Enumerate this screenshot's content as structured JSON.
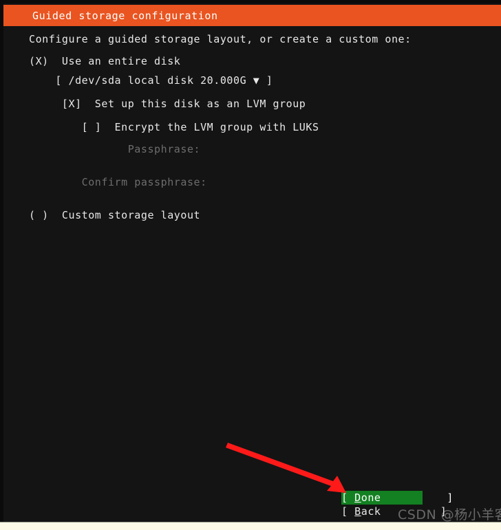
{
  "colors": {
    "header_bg": "#e95420",
    "screen_bg": "#141414",
    "text": "#e8e8e8",
    "dim_text": "#6d6d6d",
    "selected_bg": "#138021",
    "arrow": "#ff1a1a",
    "bottom_strip": "#fdfbe8"
  },
  "header": {
    "title": "Guided storage configuration"
  },
  "main": {
    "intro": "Configure a guided storage layout, or create a custom one:",
    "rows": [
      {
        "name": "use-entire-disk-radio",
        "text": "(X)  Use an entire disk",
        "dim": false,
        "interactable": true
      },
      {
        "name": "disk-selector",
        "text": "    [ /dev/sda local disk 20.000G ▼ ]",
        "dim": false,
        "interactable": true
      },
      {
        "name": "lvm-group-checkbox",
        "text": "     [X]  Set up this disk as an LVM group",
        "dim": false,
        "interactable": true
      },
      {
        "name": "luks-encrypt-checkbox",
        "text": "        [ ]  Encrypt the LVM group with LUKS",
        "dim": false,
        "interactable": true
      },
      {
        "name": "passphrase-field-label",
        "text": "               Passphrase:",
        "dim": true,
        "interactable": false
      },
      {
        "name": "confirm-passphrase-field-label",
        "text": "        Confirm passphrase:",
        "dim": true,
        "interactable": false
      },
      {
        "name": "custom-storage-layout-radio",
        "text": "( )  Custom storage layout",
        "dim": false,
        "interactable": true
      }
    ]
  },
  "footer": {
    "buttons": [
      {
        "name": "done-button",
        "prefix": "[ ",
        "accel": "D",
        "rest": "one",
        "suffix": "          ]",
        "selected": true
      },
      {
        "name": "back-button",
        "prefix": "[ ",
        "accel": "B",
        "rest": "ack",
        "suffix": "         ]",
        "selected": false
      }
    ]
  },
  "annotations": {
    "watermark": "CSDN @杨小羊客"
  }
}
